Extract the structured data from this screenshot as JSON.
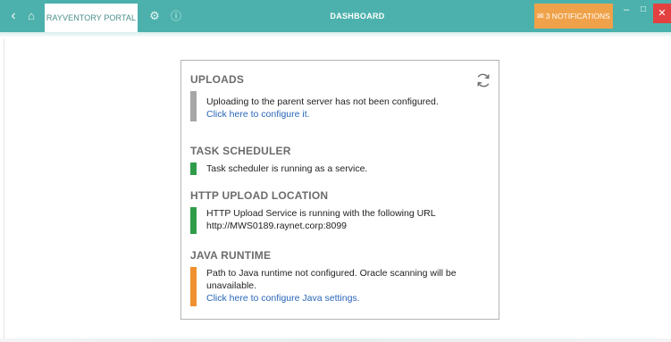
{
  "titlebar": {
    "back_glyph": "‹",
    "home_glyph": "⌂",
    "tab_label": "RAYVENTORY PORTAL",
    "settings_glyph": "⚙",
    "info_glyph": "ⓘ",
    "title": "DASHBOARD",
    "notifications_glyph": "✉",
    "notifications_label": "3 NOTIFICATIONS",
    "minimize_glyph": "–",
    "maximize_glyph": "□",
    "close_glyph": "✕"
  },
  "colors": {
    "titlebar": "#4cb1ac",
    "notification": "#f0a24a",
    "close": "#e34141",
    "status_gray": "#a6a6a6",
    "status_green": "#2f9c4a",
    "status_orange": "#f0902e",
    "link": "#2966b8"
  },
  "icons": {
    "refresh": "refresh-icon"
  },
  "card": {
    "uploads": {
      "title": "UPLOADS",
      "status": "gray",
      "line1": "Uploading to the parent server has not been configured.",
      "link": "Click here to configure it."
    },
    "task_scheduler": {
      "title": "TASK SCHEDULER",
      "status": "green",
      "line1": "Task scheduler is running as a service."
    },
    "http_upload": {
      "title": "HTTP UPLOAD LOCATION",
      "status": "green",
      "line1": "HTTP Upload Service is running with the following URL",
      "line2": "http://MWS0189.raynet.corp:8099"
    },
    "java_runtime": {
      "title": "JAVA RUNTIME",
      "status": "orange",
      "line1": "Path to Java runtime not configured. Oracle scanning will be",
      "line2": "unavailable.",
      "link": "Click here to configure Java settings."
    }
  }
}
